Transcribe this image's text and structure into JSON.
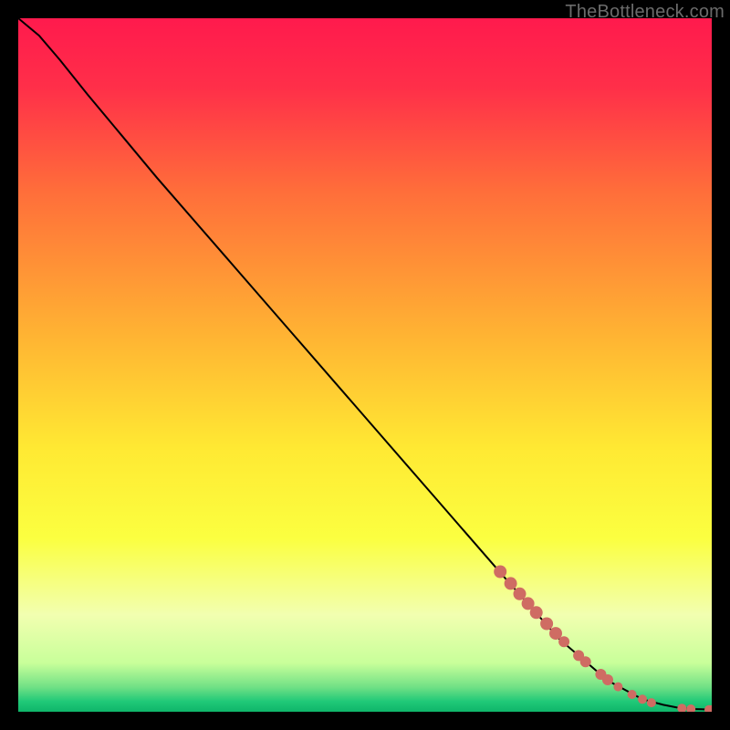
{
  "watermark": "TheBottleneck.com",
  "chart_data": {
    "type": "line",
    "title": "",
    "xlabel": "",
    "ylabel": "",
    "xlim": [
      0,
      100
    ],
    "ylim": [
      0,
      100
    ],
    "background_gradient": {
      "stops": [
        {
          "offset": 0.0,
          "color": "#ff1a4d"
        },
        {
          "offset": 0.1,
          "color": "#ff2f49"
        },
        {
          "offset": 0.25,
          "color": "#ff6e3a"
        },
        {
          "offset": 0.45,
          "color": "#ffb133"
        },
        {
          "offset": 0.62,
          "color": "#ffe933"
        },
        {
          "offset": 0.75,
          "color": "#fbff40"
        },
        {
          "offset": 0.86,
          "color": "#f2ffb0"
        },
        {
          "offset": 0.93,
          "color": "#c8ff9a"
        },
        {
          "offset": 0.965,
          "color": "#6fe085"
        },
        {
          "offset": 0.985,
          "color": "#20c978"
        },
        {
          "offset": 1.0,
          "color": "#0fb56a"
        }
      ]
    },
    "series": [
      {
        "name": "curve",
        "type": "line",
        "color": "#000000",
        "x": [
          0,
          3,
          6,
          10,
          15,
          20,
          30,
          40,
          50,
          60,
          70,
          78,
          85,
          90,
          93,
          95,
          97,
          98.5,
          100
        ],
        "y": [
          100,
          97.5,
          94,
          89,
          83,
          77,
          65.5,
          54,
          42.5,
          31,
          19.5,
          10.5,
          4.5,
          1.8,
          1.0,
          0.6,
          0.4,
          0.35,
          0.3
        ]
      },
      {
        "name": "markers",
        "type": "scatter",
        "color": "#cf6c63",
        "points": [
          {
            "x": 69.5,
            "y": 20.2,
            "r": 7
          },
          {
            "x": 71.0,
            "y": 18.5,
            "r": 7
          },
          {
            "x": 72.3,
            "y": 17.0,
            "r": 7
          },
          {
            "x": 73.5,
            "y": 15.6,
            "r": 7
          },
          {
            "x": 74.7,
            "y": 14.3,
            "r": 7
          },
          {
            "x": 76.2,
            "y": 12.7,
            "r": 7
          },
          {
            "x": 77.5,
            "y": 11.3,
            "r": 7
          },
          {
            "x": 78.7,
            "y": 10.1,
            "r": 6
          },
          {
            "x": 80.8,
            "y": 8.1,
            "r": 6
          },
          {
            "x": 81.8,
            "y": 7.2,
            "r": 6
          },
          {
            "x": 84.0,
            "y": 5.4,
            "r": 6
          },
          {
            "x": 85.0,
            "y": 4.6,
            "r": 6
          },
          {
            "x": 86.5,
            "y": 3.6,
            "r": 5
          },
          {
            "x": 88.5,
            "y": 2.5,
            "r": 5
          },
          {
            "x": 90.0,
            "y": 1.8,
            "r": 5
          },
          {
            "x": 91.3,
            "y": 1.3,
            "r": 5
          },
          {
            "x": 95.7,
            "y": 0.5,
            "r": 5
          },
          {
            "x": 97.0,
            "y": 0.4,
            "r": 5
          },
          {
            "x": 99.6,
            "y": 0.3,
            "r": 5
          },
          {
            "x": 100.0,
            "y": 0.3,
            "r": 5
          }
        ]
      }
    ]
  }
}
